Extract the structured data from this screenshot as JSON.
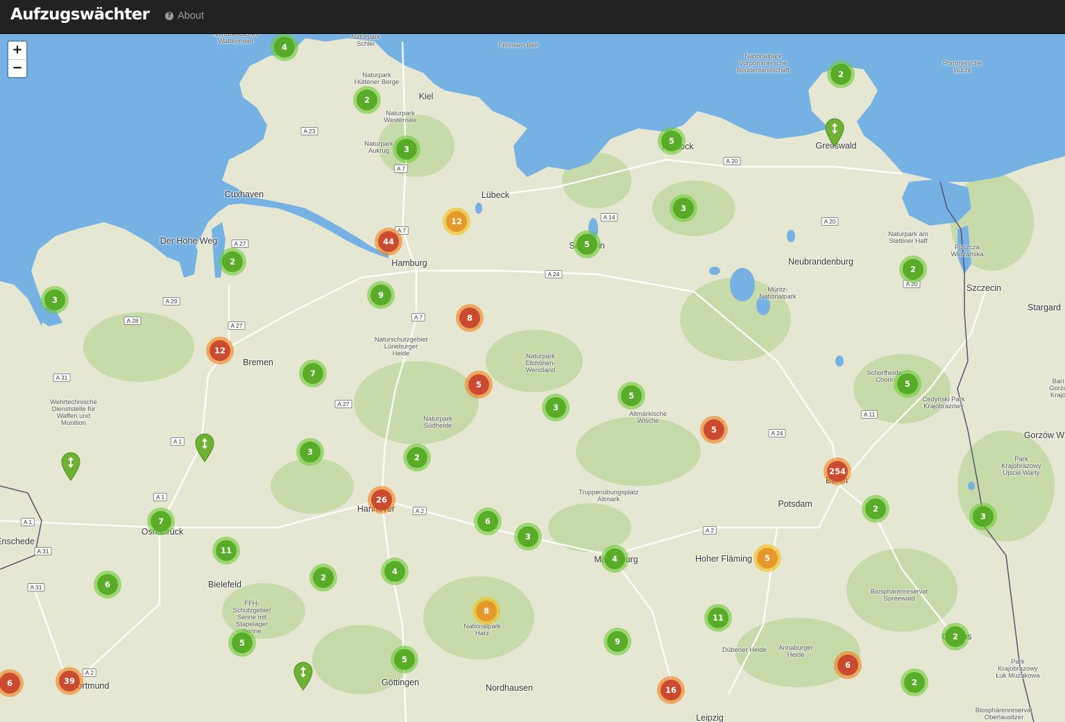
{
  "app": {
    "brand": "Aufzugswächter",
    "nav_about": "About"
  },
  "zoom": {
    "in_label": "+",
    "out_label": "−"
  },
  "colors": {
    "water": "#75b2e3",
    "land": "#e6e7d2",
    "forest": "#b9d49a",
    "cluster_green": "#54aa24",
    "cluster_yellow": "#e69628",
    "cluster_red": "#c8462d"
  },
  "clusters": [
    {
      "count": "4",
      "status": "green"
    },
    {
      "count": "2",
      "status": "green"
    },
    {
      "count": "3",
      "status": "green"
    },
    {
      "count": "2",
      "status": "green"
    },
    {
      "count": "5",
      "status": "green"
    },
    {
      "count": "12",
      "status": "yellow"
    },
    {
      "count": "44",
      "status": "red"
    },
    {
      "count": "5",
      "status": "green"
    },
    {
      "count": "3",
      "status": "green"
    },
    {
      "count": "2",
      "status": "green"
    },
    {
      "count": "3",
      "status": "green"
    },
    {
      "count": "2",
      "status": "green"
    },
    {
      "count": "9",
      "status": "green"
    },
    {
      "count": "8",
      "status": "red"
    },
    {
      "count": "12",
      "status": "red"
    },
    {
      "count": "7",
      "status": "green"
    },
    {
      "count": "5",
      "status": "red"
    },
    {
      "count": "3",
      "status": "green"
    },
    {
      "count": "5",
      "status": "green"
    },
    {
      "count": "5",
      "status": "green"
    },
    {
      "count": "5",
      "status": "red"
    },
    {
      "count": "3",
      "status": "green"
    },
    {
      "count": "2",
      "status": "green"
    },
    {
      "count": "254",
      "status": "red"
    },
    {
      "count": "26",
      "status": "red"
    },
    {
      "count": "7",
      "status": "green"
    },
    {
      "count": "6",
      "status": "green"
    },
    {
      "count": "3",
      "status": "green"
    },
    {
      "count": "2",
      "status": "green"
    },
    {
      "count": "3",
      "status": "green"
    },
    {
      "count": "11",
      "status": "green"
    },
    {
      "count": "4",
      "status": "green"
    },
    {
      "count": "5",
      "status": "yellow"
    },
    {
      "count": "6",
      "status": "green"
    },
    {
      "count": "2",
      "status": "green"
    },
    {
      "count": "4",
      "status": "green"
    },
    {
      "count": "8",
      "status": "yellow"
    },
    {
      "count": "11",
      "status": "green"
    },
    {
      "count": "9",
      "status": "green"
    },
    {
      "count": "2",
      "status": "green"
    },
    {
      "count": "5",
      "status": "green"
    },
    {
      "count": "5",
      "status": "green"
    },
    {
      "count": "6",
      "status": "red"
    },
    {
      "count": "6",
      "status": "red"
    },
    {
      "count": "39",
      "status": "red"
    },
    {
      "count": "16",
      "status": "red"
    },
    {
      "count": "2",
      "status": "green"
    }
  ],
  "place_labels": [
    "Kiel",
    "Lübeck",
    "Rostock",
    "Greifswald",
    "Cuxhaven",
    "Hamburg",
    "Schwerin",
    "Neubrandenburg",
    "Szczecin",
    "Stargard",
    "Bremen",
    "Berlin",
    "Potsdam",
    "Hannover",
    "Osnabrück",
    "Bielefeld",
    "Magdeburg",
    "Göttingen",
    "Nordhausen",
    "Dortmund",
    "Leipzig",
    "Enschede",
    "Gorzów W",
    "Cottbus",
    "Der Hohe Weg",
    "Hoher Fläming"
  ],
  "area_labels": [
    "Nordfriesisches\nWattenmeer",
    "Naturpark\nSchlei",
    "Fehmarn Belt",
    "Naturpark\nHüttener Berge",
    "Naturpark\nWestensee",
    "Naturpark\nAukrug",
    "Nationalpark\nVorpommersche\nBoddenlandschaft",
    "Pommersche\nBucht",
    "Naturpark am\nStettiner Haff",
    "Puszcza\nWkrzańska",
    "Müritz-\nNationalpark",
    "Naturschutzgebiet\nLüneburger\nHeide",
    "Naturpark\nElbhöhen-\nWendland",
    "Naturpark\nSüdheide",
    "Altmärkische\nWische",
    "Wehrtechnische\nDienststelle für\nWaffen und\nMunition",
    "Truppenübungsplatz\nAltmark",
    "Schorfheide-\nChorin",
    "Cedyński Park\nKrajobrazowy",
    "Park\nKrajobrazowy\nUjście Warty",
    "FFH-\nSchutzgebiet\nSenne mit\nStapelager\nSenne",
    "Nationalpark\nHarz",
    "Biosphärenreservat\nSpreewald",
    "Dübener Heide",
    "Annaburger\nHeide",
    "Park\nKrajobrazowy\nŁuk Mużakowa",
    "Biosphärenreservat\nOberlausitzer",
    "Bari\nGorzo\nKrajo"
  ],
  "road_labels": [
    "A 23",
    "A 7",
    "A 7",
    "A 27",
    "A 29",
    "A 28",
    "A 27",
    "A 31",
    "A 1",
    "A 1",
    "A 1",
    "A 31",
    "A 31",
    "A 27",
    "A 7",
    "A 24",
    "A 14",
    "A 20",
    "A 20",
    "A 20",
    "A 24",
    "A 11",
    "A 2",
    "A 2",
    "A 2"
  ]
}
